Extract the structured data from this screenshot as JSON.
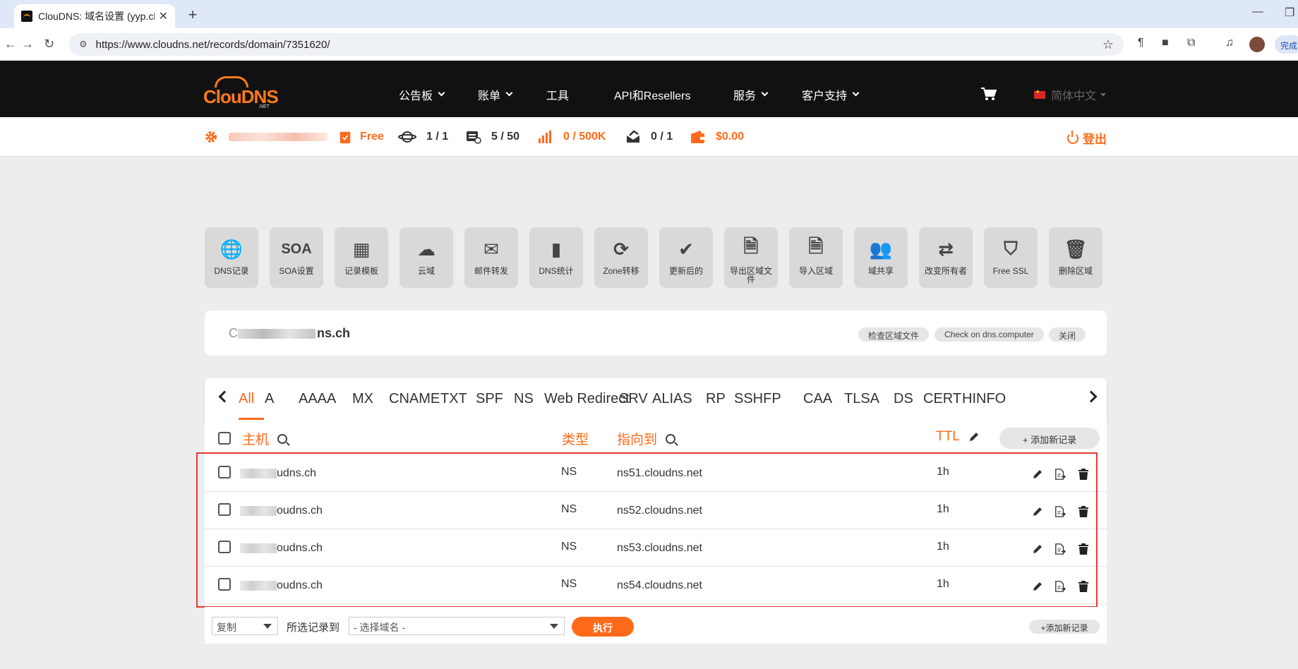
{
  "browser": {
    "tab_title": "ClouDNS: 域名设置 (yyp.cloudns.ch)",
    "url": "https://www.cloudns.net/records/domain/7351620/",
    "done_label": "完成"
  },
  "header": {
    "logo_text": "ClouDNS",
    "logo_sub": ".NET",
    "nav": [
      "公告板",
      "账单",
      "工具",
      "API和Resellers",
      "服务",
      "客户支持"
    ],
    "language": "简体中文"
  },
  "account": {
    "plan": "Free",
    "zones": "1 / 1",
    "records": "5 / 50",
    "queries": "0 / 500K",
    "mail": "0 / 1",
    "balance": "$0.00",
    "logout": "登出"
  },
  "tiles": [
    {
      "icon": "globe-icon",
      "label": "DNS记录",
      "glyph": "🌐"
    },
    {
      "icon": "soa-icon",
      "label": "SOA设置",
      "glyph": "SOA"
    },
    {
      "icon": "template-icon",
      "label": "记录模板",
      "glyph": "▦"
    },
    {
      "icon": "cloud-icon",
      "label": "云域",
      "glyph": "☁"
    },
    {
      "icon": "mail-forward-icon",
      "label": "邮件转发",
      "glyph": "✉"
    },
    {
      "icon": "stats-icon",
      "label": "DNS统计",
      "glyph": "▮"
    },
    {
      "icon": "zone-transfer-icon",
      "label": "Zone转移",
      "glyph": "⟳"
    },
    {
      "icon": "check-icon",
      "label": "更新后的",
      "glyph": "✔"
    },
    {
      "icon": "export-icon",
      "label": "导出区域文件",
      "glyph": "🗎"
    },
    {
      "icon": "import-icon",
      "label": "导入区域",
      "glyph": "🗎"
    },
    {
      "icon": "share-icon",
      "label": "域共享",
      "glyph": "👥"
    },
    {
      "icon": "change-owner-icon",
      "label": "改变所有者",
      "glyph": "⇄"
    },
    {
      "icon": "ssl-shield-icon",
      "label": "Free SSL",
      "glyph": "⛉"
    },
    {
      "icon": "trash-icon",
      "label": "删除区域",
      "glyph": "🗑"
    }
  ],
  "domain": {
    "name_suffix": "ns.ch",
    "name_prefix": "C",
    "buttons": [
      "检查区域文件",
      "Check on dns.computer",
      "关闭"
    ]
  },
  "record_types": [
    "All",
    "A",
    "AAAA",
    "MX",
    "CNAME",
    "TXT",
    "SPF",
    "NS",
    "Web Redirect",
    "SRV",
    "ALIAS",
    "RP",
    "SSHFP",
    "CAA",
    "TLSA",
    "DS",
    "CERT",
    "HINFO"
  ],
  "table": {
    "col_host": "主机",
    "col_type": "类型",
    "col_target": "指向到",
    "col_ttl": "TTL",
    "add_record": "+ 添加新记录",
    "rows": [
      {
        "host": "udns.ch",
        "type": "NS",
        "target": "ns51.cloudns.net",
        "ttl": "1h"
      },
      {
        "host": "oudns.ch",
        "type": "NS",
        "target": "ns52.cloudns.net",
        "ttl": "1h"
      },
      {
        "host": "oudns.ch",
        "type": "NS",
        "target": "ns53.cloudns.net",
        "ttl": "1h"
      },
      {
        "host": "oudns.ch",
        "type": "NS",
        "target": "ns54.cloudns.net",
        "ttl": "1h"
      }
    ]
  },
  "bottom": {
    "action_select": "复制",
    "label": "所选记录到",
    "domain_select": "- 选择域名 -",
    "execute": "执行",
    "add_record": "+添加新记录"
  },
  "colors": {
    "accent": "#ff6a1a",
    "header_bg": "#111111",
    "highlight": "#e53935"
  }
}
